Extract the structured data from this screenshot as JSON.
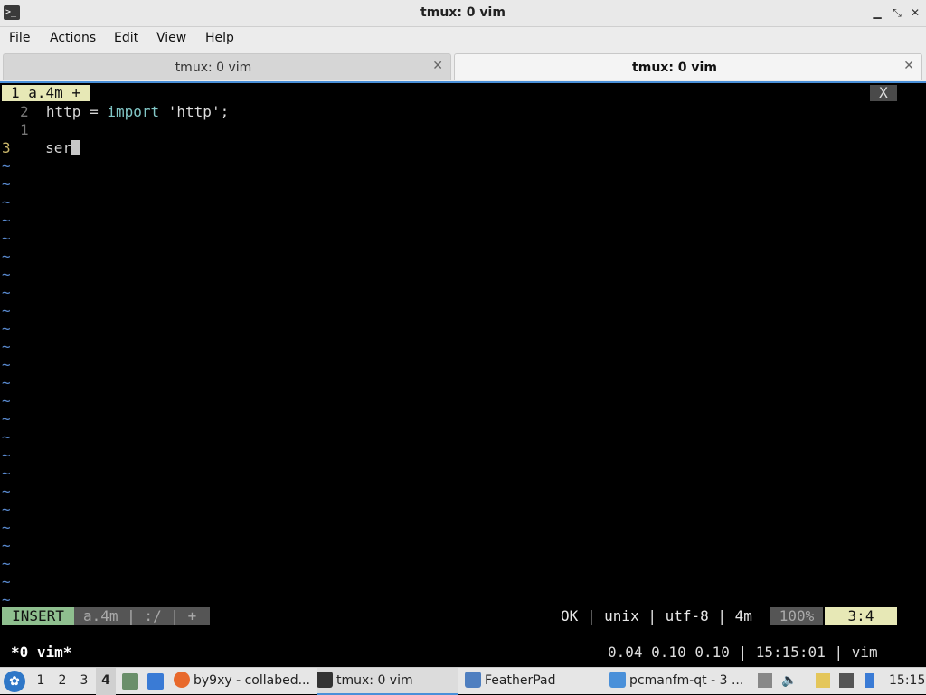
{
  "window": {
    "title": "tmux: 0 vim"
  },
  "menu": [
    "File",
    "Actions",
    "Edit",
    "View",
    "Help"
  ],
  "tabs": [
    {
      "label": "tmux: 0 vim",
      "active": false
    },
    {
      "label": "tmux: 0 vim",
      "active": true
    }
  ],
  "vim": {
    "buffer_tab": "1 a.4m +",
    "close_label": "X",
    "lines": [
      {
        "num": "2",
        "code_var": "http = ",
        "code_kw": "import",
        "code_str": " 'http';"
      },
      {
        "num": "1",
        "text": ""
      },
      {
        "num": "3",
        "text": "ser"
      }
    ],
    "status": {
      "mode": "INSERT",
      "file_info": "a.4m | :/ | +",
      "right_info": "OK | unix | utf-8 | 4m",
      "percent": "100%",
      "position": "3:4"
    }
  },
  "tmux": {
    "window_list": "*0 vim*",
    "status_right": "0.04 0.10 0.10 | 15:15:01 | vim"
  },
  "taskbar": {
    "workspaces": [
      "1",
      "2",
      "3",
      "4"
    ],
    "current_workspace": "4",
    "tasks": [
      {
        "label": "by9xy - collabed...",
        "icon": "firefox-icon"
      },
      {
        "label": "tmux: 0 vim",
        "icon": "terminal-icon",
        "active": true
      },
      {
        "label": "FeatherPad",
        "icon": "featherpad-icon"
      },
      {
        "label": "pcmanfm-qt - 3 ...",
        "icon": "folder-icon"
      }
    ],
    "clock": "15:15"
  },
  "colors": {
    "accent": "#4a90d9",
    "mode_bg": "#8fbf8f",
    "position_bg": "#e7e8b6",
    "tilde": "#5a8bd1"
  }
}
